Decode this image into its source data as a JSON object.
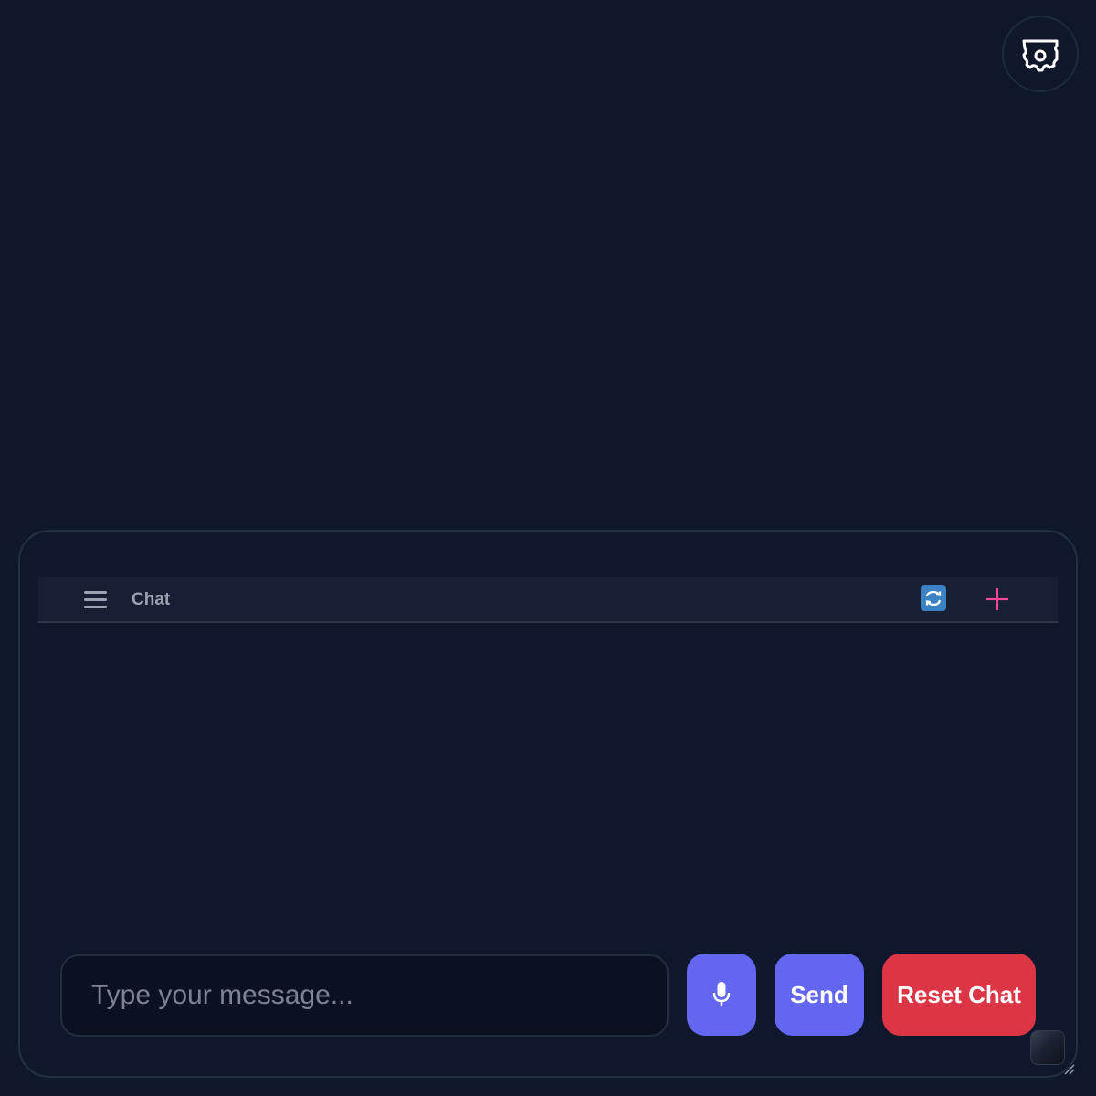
{
  "settings": {
    "icon": "gear-icon"
  },
  "chat": {
    "title": "Chat",
    "menu_icon": "hamburger-menu-icon",
    "refresh_icon": "refresh-icon",
    "new_icon": "plus-icon",
    "input": {
      "placeholder": "Type your message...",
      "value": ""
    },
    "buttons": {
      "mic_icon": "microphone-icon",
      "send_label": "Send",
      "reset_label": "Reset Chat"
    }
  },
  "colors": {
    "background": "#0f172a",
    "accent": "#6366f1",
    "danger": "#dc3545",
    "plus": "#ec4899",
    "refresh": "#3b82c4"
  }
}
